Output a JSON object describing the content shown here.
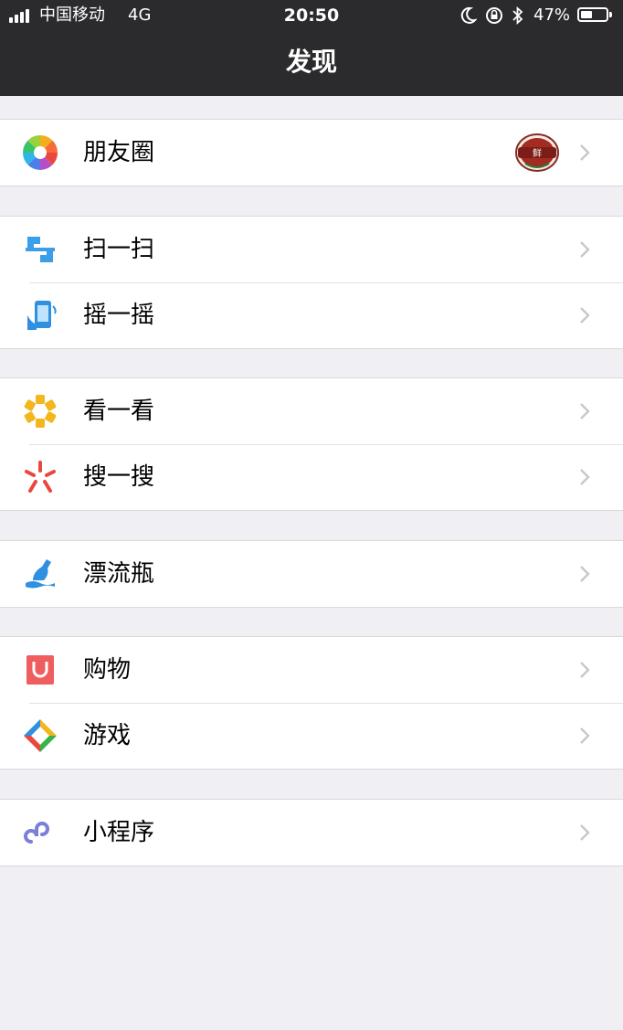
{
  "status_bar": {
    "carrier": "中国移动",
    "network": "4G",
    "time": "20:50",
    "battery_percent": "47%",
    "battery_level": 0.47,
    "icons": [
      "signal-icon",
      "moon-icon",
      "orientation-lock-icon",
      "bluetooth-icon",
      "battery-icon"
    ]
  },
  "nav": {
    "title": "发现"
  },
  "groups": [
    {
      "items": [
        {
          "label": "朋友圈",
          "icon": "moments-icon",
          "badge": "鲜"
        }
      ]
    },
    {
      "items": [
        {
          "label": "扫一扫",
          "icon": "scan-icon"
        },
        {
          "label": "摇一摇",
          "icon": "shake-icon"
        }
      ]
    },
    {
      "items": [
        {
          "label": "看一看",
          "icon": "top-stories-icon"
        },
        {
          "label": "搜一搜",
          "icon": "search-icon"
        }
      ]
    },
    {
      "items": [
        {
          "label": "漂流瓶",
          "icon": "drift-bottle-icon"
        }
      ]
    },
    {
      "items": [
        {
          "label": "购物",
          "icon": "shopping-icon"
        },
        {
          "label": "游戏",
          "icon": "games-icon"
        }
      ]
    },
    {
      "items": [
        {
          "label": "小程序",
          "icon": "mini-programs-icon"
        }
      ]
    }
  ],
  "colors": {
    "nav_background": "#2b2b2d",
    "page_background": "#efeff4",
    "chevron": "#c7c7cc"
  }
}
